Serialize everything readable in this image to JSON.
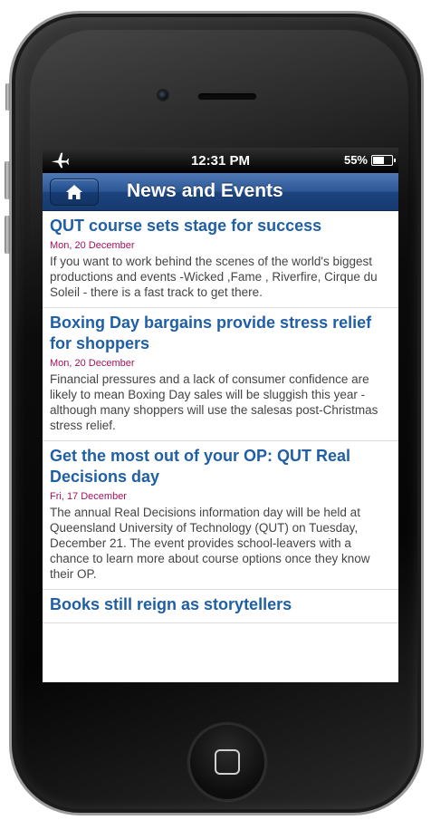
{
  "status_bar": {
    "time": "12:31 PM",
    "battery_percent": "55%",
    "battery_level": 0.55,
    "airplane_icon": "airplane-icon"
  },
  "nav": {
    "title": "News and Events",
    "home_icon": "house-icon"
  },
  "articles": [
    {
      "title": "QUT course sets stage for success",
      "date": "Mon, 20 December",
      "summary": "If you want to work behind the scenes of the world's biggest productions and events -Wicked ,Fame , Riverfire, Cirque du Soleil - there is a fast track to get there."
    },
    {
      "title": "Boxing Day bargains provide stress relief for shoppers",
      "date": "Mon, 20 December",
      "summary": "Financial pressures and a lack of consumer confidence are likely to mean Boxing Day sales will be sluggish this year - although many shoppers will use the salesas post-Christmas stress relief."
    },
    {
      "title": "Get the most out of your OP: QUT Real Decisions day",
      "date": "Fri, 17 December",
      "summary": "The annual Real Decisions information day will be held at Queensland University of Technology (QUT) on Tuesday, December 21. The event provides school-leavers with a chance to learn more about course options once they know their OP."
    },
    {
      "title": "Books still reign as storytellers",
      "date": "",
      "summary": ""
    }
  ],
  "colors": {
    "nav_blue": "#2c5694",
    "title_blue": "#1f5fa6",
    "date_magenta": "#a3125a"
  }
}
